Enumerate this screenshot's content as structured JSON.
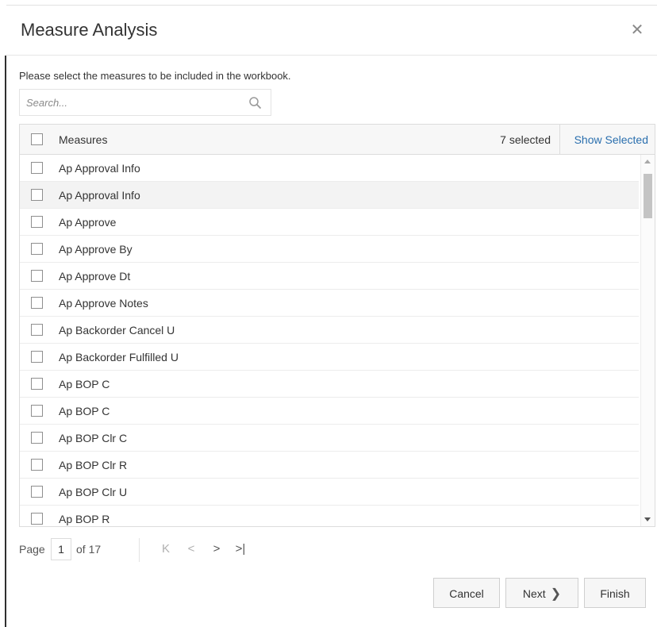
{
  "dialog": {
    "title": "Measure Analysis",
    "close_icon": "close-icon",
    "instruction": "Please select the measures to be included in the workbook."
  },
  "search": {
    "placeholder": "Search...",
    "value": "",
    "icon": "search-icon"
  },
  "table": {
    "header": {
      "label": "Measures",
      "selected_count": "7 selected",
      "show_selected": "Show Selected"
    },
    "rows": [
      {
        "label": "Ap Approval Info",
        "checked": false
      },
      {
        "label": "Ap Approval Info",
        "checked": false
      },
      {
        "label": "Ap Approve",
        "checked": false
      },
      {
        "label": "Ap Approve By",
        "checked": false
      },
      {
        "label": "Ap Approve Dt",
        "checked": false
      },
      {
        "label": "Ap Approve Notes",
        "checked": false
      },
      {
        "label": "Ap Backorder Cancel U",
        "checked": false
      },
      {
        "label": "Ap Backorder Fulfilled U",
        "checked": false
      },
      {
        "label": "Ap BOP C",
        "checked": false
      },
      {
        "label": "Ap BOP C",
        "checked": false
      },
      {
        "label": "Ap BOP Clr C",
        "checked": false
      },
      {
        "label": "Ap BOP Clr R",
        "checked": false
      },
      {
        "label": "Ap BOP Clr U",
        "checked": false
      },
      {
        "label": "Ap BOP R",
        "checked": false
      }
    ]
  },
  "pager": {
    "page_label": "Page",
    "current_page": "1",
    "of_label": "of 17",
    "first_icon": "K",
    "prev_icon": "<",
    "next_icon": ">",
    "last_icon": ">|"
  },
  "footer": {
    "cancel_label": "Cancel",
    "next_label": "Next",
    "finish_label": "Finish"
  },
  "colors": {
    "link": "#2a6fae",
    "row_highlight": "#f3f3f3",
    "header_bg": "#f7f7f7"
  }
}
